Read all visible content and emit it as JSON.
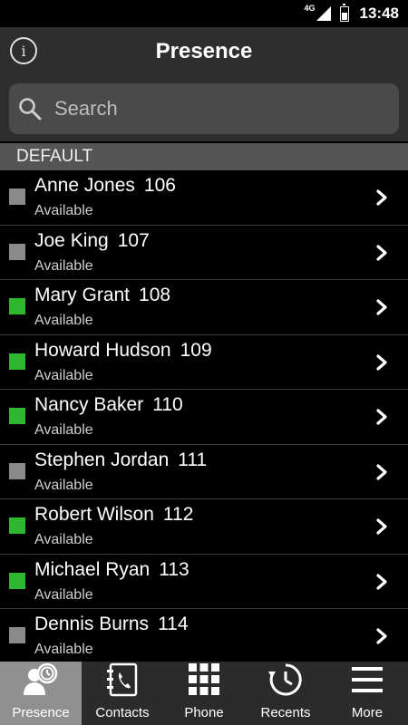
{
  "status_bar": {
    "network": "4G",
    "time": "13:48"
  },
  "header": {
    "title": "Presence",
    "info_icon": "info-icon"
  },
  "search": {
    "placeholder": "Search",
    "icon": "search-icon"
  },
  "group": {
    "label": "DEFAULT"
  },
  "colors": {
    "available": "#2fb82f",
    "offline": "#8a8a8a",
    "header_bg": "#2e2e2e",
    "group_bg": "#555555"
  },
  "contacts": [
    {
      "name": "Anne Jones",
      "ext": "106",
      "status": "Available",
      "indicator": "offline"
    },
    {
      "name": "Joe King",
      "ext": "107",
      "status": "Available",
      "indicator": "offline"
    },
    {
      "name": "Mary Grant",
      "ext": "108",
      "status": "Available",
      "indicator": "available"
    },
    {
      "name": "Howard Hudson",
      "ext": "109",
      "status": "Available",
      "indicator": "available"
    },
    {
      "name": "Nancy Baker",
      "ext": "110",
      "status": "Available",
      "indicator": "available"
    },
    {
      "name": "Stephen Jordan",
      "ext": "111",
      "status": "Available",
      "indicator": "offline"
    },
    {
      "name": "Robert Wilson",
      "ext": "112",
      "status": "Available",
      "indicator": "available"
    },
    {
      "name": "Michael Ryan",
      "ext": "113",
      "status": "Available",
      "indicator": "available"
    },
    {
      "name": "Dennis Burns",
      "ext": "114",
      "status": "Available",
      "indicator": "offline"
    }
  ],
  "tabs": [
    {
      "label": "Presence",
      "icon": "presence-icon",
      "active": true
    },
    {
      "label": "Contacts",
      "icon": "contacts-icon",
      "active": false
    },
    {
      "label": "Phone",
      "icon": "dialpad-icon",
      "active": false
    },
    {
      "label": "Recents",
      "icon": "recents-icon",
      "active": false
    },
    {
      "label": "More",
      "icon": "menu-icon",
      "active": false
    }
  ]
}
